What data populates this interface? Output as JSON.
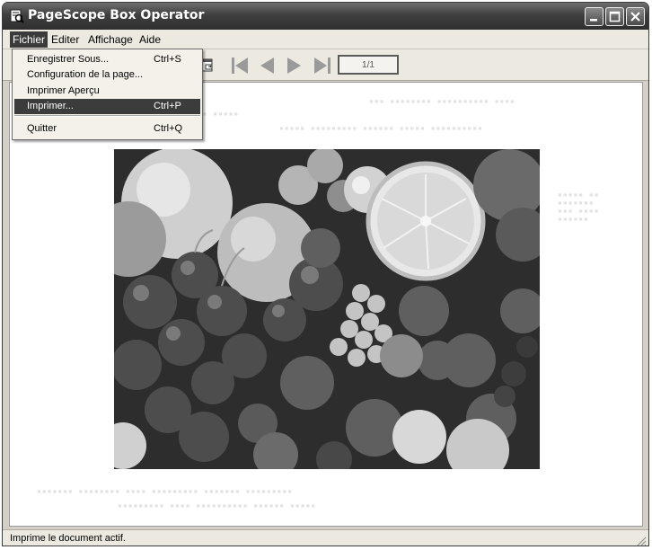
{
  "window": {
    "title": "PageScope Box Operator"
  },
  "menubar": {
    "items": [
      {
        "label": "Fichier"
      },
      {
        "label": "Editer"
      },
      {
        "label": "Affichage"
      },
      {
        "label": "Aide"
      }
    ]
  },
  "file_menu": {
    "items": [
      {
        "label": "Enregistrer Sous...",
        "shortcut": "Ctrl+S"
      },
      {
        "label": "Configuration de la page...",
        "shortcut": ""
      },
      {
        "label": "Imprimer Aperçu",
        "shortcut": ""
      },
      {
        "label": "Imprimer...",
        "shortcut": "Ctrl+P",
        "highlighted": true
      },
      {
        "label": "Quitter",
        "shortcut": "Ctrl+Q"
      }
    ]
  },
  "toolbar": {
    "page_indicator": "1/1"
  },
  "statusbar": {
    "text": "Imprime le document actif."
  },
  "colors": {
    "titlebar": "#3f3f3f",
    "menu_highlight": "#3c3c3c",
    "chrome": "#ece9e0"
  }
}
